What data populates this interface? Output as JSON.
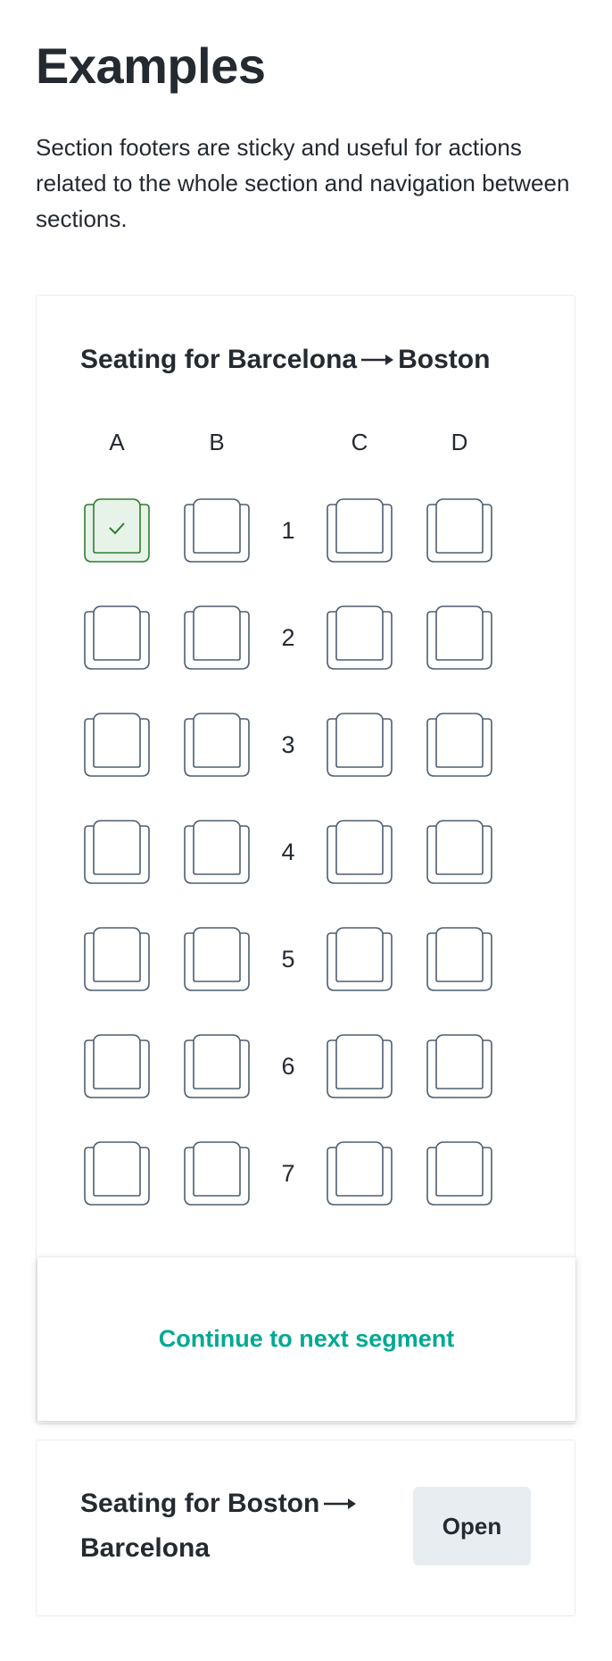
{
  "page": {
    "title": "Examples",
    "intro": "Section footers are sticky and useful for actions related to the whole section and navigation between sections."
  },
  "colors": {
    "text": "#252a31",
    "seat_outline": "#4f5e71",
    "seat_selected_fill": "#e7f3e8",
    "seat_selected_outline": "#2e7d32",
    "accent_green": "#00a991",
    "button_secondary_bg": "#e8edf1"
  },
  "segment_one": {
    "title_from": "Seating for Barcelona",
    "title_to": "Boston",
    "arrow_icon": "arrow-right-icon",
    "columns": [
      "A",
      "B",
      "C",
      "D"
    ],
    "rows": [
      "1",
      "2",
      "3",
      "4",
      "5",
      "6",
      "7"
    ],
    "selected_seats": [
      "1A"
    ],
    "footer_action": "Continue to next segment"
  },
  "segment_two": {
    "title_from": "Seating for Boston",
    "title_to": "Barcelona",
    "arrow_icon": "arrow-right-icon",
    "action_label": "Open"
  }
}
